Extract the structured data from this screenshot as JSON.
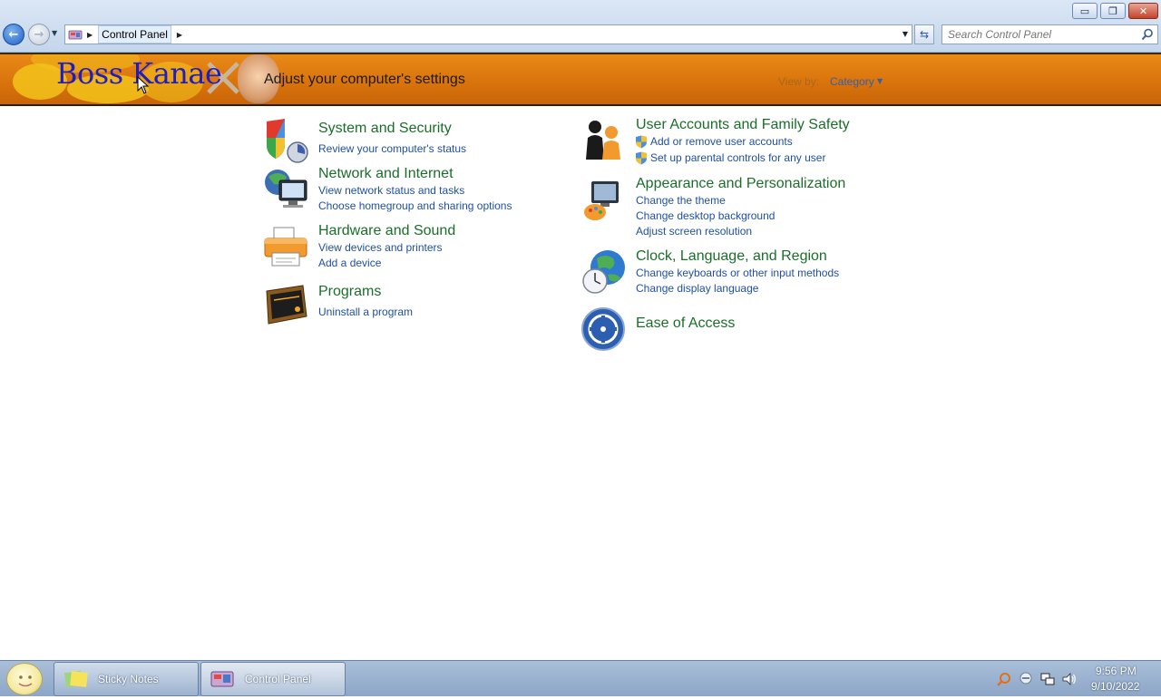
{
  "window": {
    "minimize_symbol": "▭",
    "maximize_symbol": "❐",
    "close_symbol": "✕"
  },
  "address": {
    "breadcrumb": "Control Panel",
    "search_placeholder": "Search Control Panel"
  },
  "banner": {
    "logo_text": "Boss Kanae",
    "title": "Adjust your computer's settings",
    "view_by_label": "View by:",
    "view_by_value": "Category"
  },
  "categories": {
    "system_security": {
      "title": "System and Security",
      "links": [
        "Review your computer's status"
      ]
    },
    "network_internet": {
      "title": "Network and Internet",
      "links": [
        "View network status and tasks",
        "Choose homegroup and sharing options"
      ]
    },
    "hardware_sound": {
      "title": "Hardware and Sound",
      "links": [
        "View devices and printers",
        "Add a device"
      ]
    },
    "programs": {
      "title": "Programs",
      "links": [
        "Uninstall a program"
      ]
    },
    "user_accounts": {
      "title": "User Accounts and Family Safety",
      "links": [
        "Add or remove user accounts",
        "Set up parental controls for any user"
      ]
    },
    "appearance": {
      "title": "Appearance and Personalization",
      "links": [
        "Change the theme",
        "Change desktop background",
        "Adjust screen resolution"
      ]
    },
    "clock_region": {
      "title": "Clock, Language, and Region",
      "links": [
        "Change keyboards or other input methods",
        "Change display language"
      ]
    },
    "ease_access": {
      "title": "Ease of Access",
      "links": []
    }
  },
  "taskbar": {
    "items": [
      {
        "label": "Sticky Notes"
      },
      {
        "label": "Control Panel"
      }
    ],
    "time": "9:56 PM",
    "date": "9/10/2022"
  },
  "icons": {
    "search": "search-icon",
    "shield": "shield-icon",
    "globe": "globe-icon",
    "printer": "printer-icon"
  }
}
